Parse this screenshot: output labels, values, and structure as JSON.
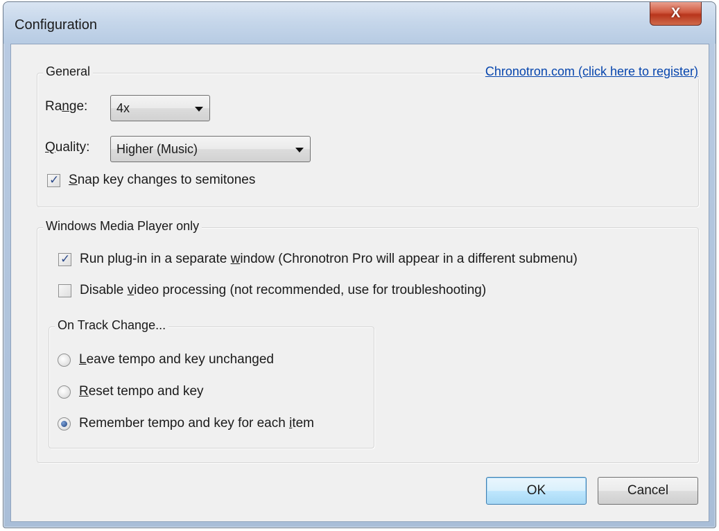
{
  "window": {
    "title": "Configuration",
    "close_label": "X"
  },
  "general": {
    "legend": "General",
    "register_link": "Chronotron.com (click here to register)",
    "range": {
      "label_pre": "Ra",
      "label_acc": "n",
      "label_post": "ge:",
      "value": "4x"
    },
    "quality": {
      "label_pre": "",
      "label_acc": "Q",
      "label_post": "uality:",
      "value": "Higher (Music)"
    },
    "snap": {
      "checked": true,
      "label_pre": "",
      "label_acc": "S",
      "label_post": "nap key changes to semitones"
    }
  },
  "wmp": {
    "legend": "Windows Media Player only",
    "separate_window": {
      "checked": true,
      "label_pre": "Run plug-in in a separate ",
      "label_acc": "w",
      "label_post": "indow (Chronotron Pro will appear in a different submenu)"
    },
    "disable_video": {
      "checked": false,
      "label_pre": "Disable ",
      "label_acc": "v",
      "label_post": "ideo processing (not recommended, use for troubleshooting)"
    }
  },
  "track_change": {
    "legend": "On Track Change...",
    "options": [
      {
        "label_pre": "",
        "label_acc": "L",
        "label_post": "eave tempo and key unchanged",
        "selected": false
      },
      {
        "label_pre": "",
        "label_acc": "R",
        "label_post": "eset tempo and key",
        "selected": false
      },
      {
        "label_pre": "Remember tempo and key for each ",
        "label_acc": "i",
        "label_post": "tem",
        "selected": true
      }
    ]
  },
  "buttons": {
    "ok": "OK",
    "cancel": "Cancel"
  }
}
